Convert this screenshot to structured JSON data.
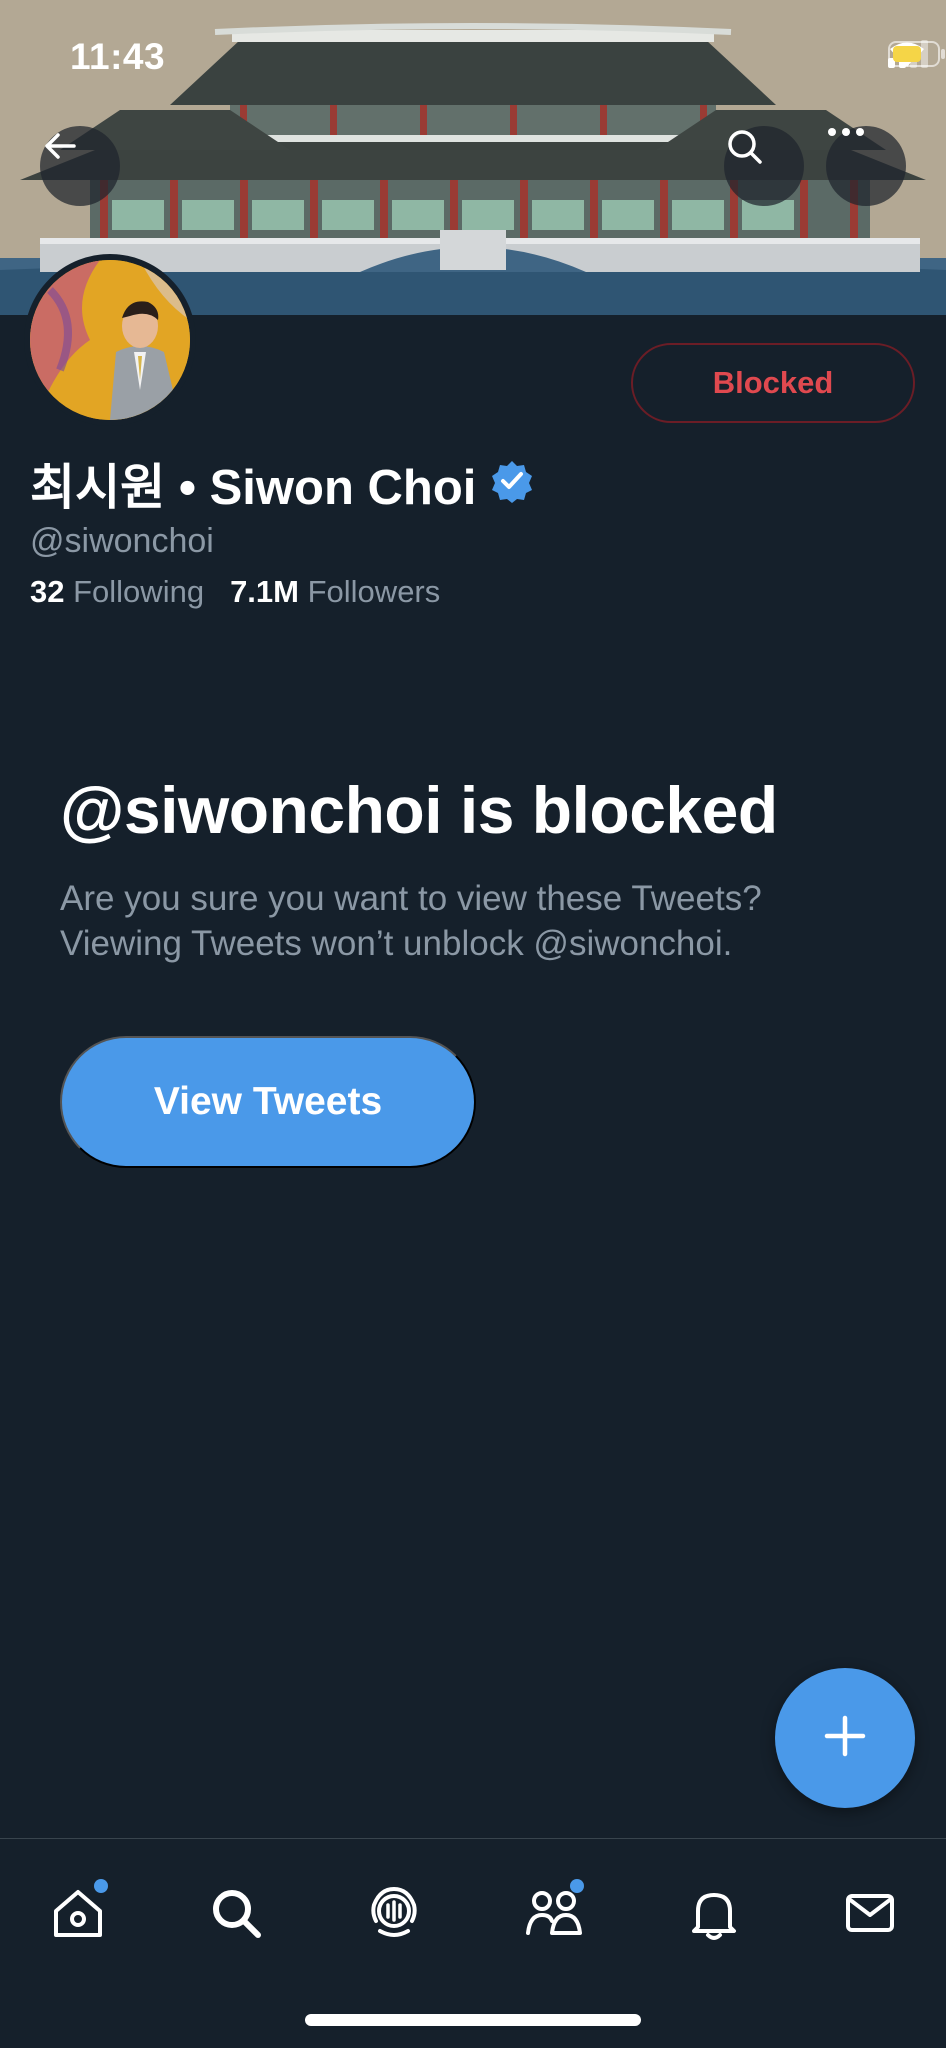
{
  "status_bar": {
    "time": "11:43",
    "icons": [
      "signal-icon",
      "wifi-icon",
      "battery-icon"
    ]
  },
  "header": {
    "back_icon": "arrow-left-icon",
    "search_icon": "search-icon",
    "more_icon": "more-horizontal-icon"
  },
  "profile": {
    "display_name": "최시원 • Siwon Choi",
    "verified": true,
    "handle": "@siwonchoi",
    "following_count": "32",
    "following_label": "Following",
    "followers_count": "7.1M",
    "followers_label": "Followers",
    "blocked_button_label": "Blocked"
  },
  "blocked_notice": {
    "title": "@siwonchoi is blocked",
    "description": "Are you sure you want to view these Tweets? Viewing Tweets won’t unblock @siwonchoi.",
    "button_label": "View Tweets"
  },
  "tab_bar": {
    "items": [
      {
        "name": "home",
        "icon": "home-icon",
        "badge": true
      },
      {
        "name": "search",
        "icon": "search-icon",
        "badge": false
      },
      {
        "name": "spaces",
        "icon": "spaces-icon",
        "badge": false
      },
      {
        "name": "communities",
        "icon": "communities-icon",
        "badge": true
      },
      {
        "name": "notifications",
        "icon": "bell-icon",
        "badge": false
      },
      {
        "name": "messages",
        "icon": "mail-icon",
        "badge": false
      }
    ]
  },
  "colors": {
    "background": "#15202b",
    "accent": "#4a99e9",
    "blocked_red": "#e0494f",
    "secondary_text": "#8b98a5"
  }
}
